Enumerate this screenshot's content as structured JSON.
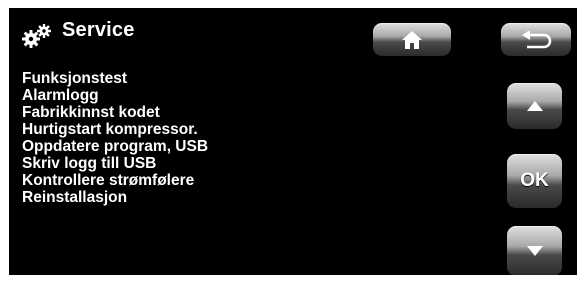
{
  "header": {
    "title": "Service",
    "icon": "gears-icon"
  },
  "nav": {
    "home_icon": "home-icon",
    "back_icon": "back-arrow-icon",
    "up_icon": "arrow-up-icon",
    "ok_label": "OK",
    "down_icon": "arrow-down-icon"
  },
  "menu": {
    "items": [
      {
        "label": "Funksjonstest"
      },
      {
        "label": "Alarmlogg"
      },
      {
        "label": "Fabrikkinnst kodet"
      },
      {
        "label": "Hurtigstart kompressor."
      },
      {
        "label": "Oppdatere program, USB"
      },
      {
        "label": "Skriv logg till USB"
      },
      {
        "label": "Kontrollere strømfølere"
      },
      {
        "label": "Reinstallasjon"
      }
    ]
  },
  "colors": {
    "background": "#000000",
    "text": "#ffffff"
  }
}
